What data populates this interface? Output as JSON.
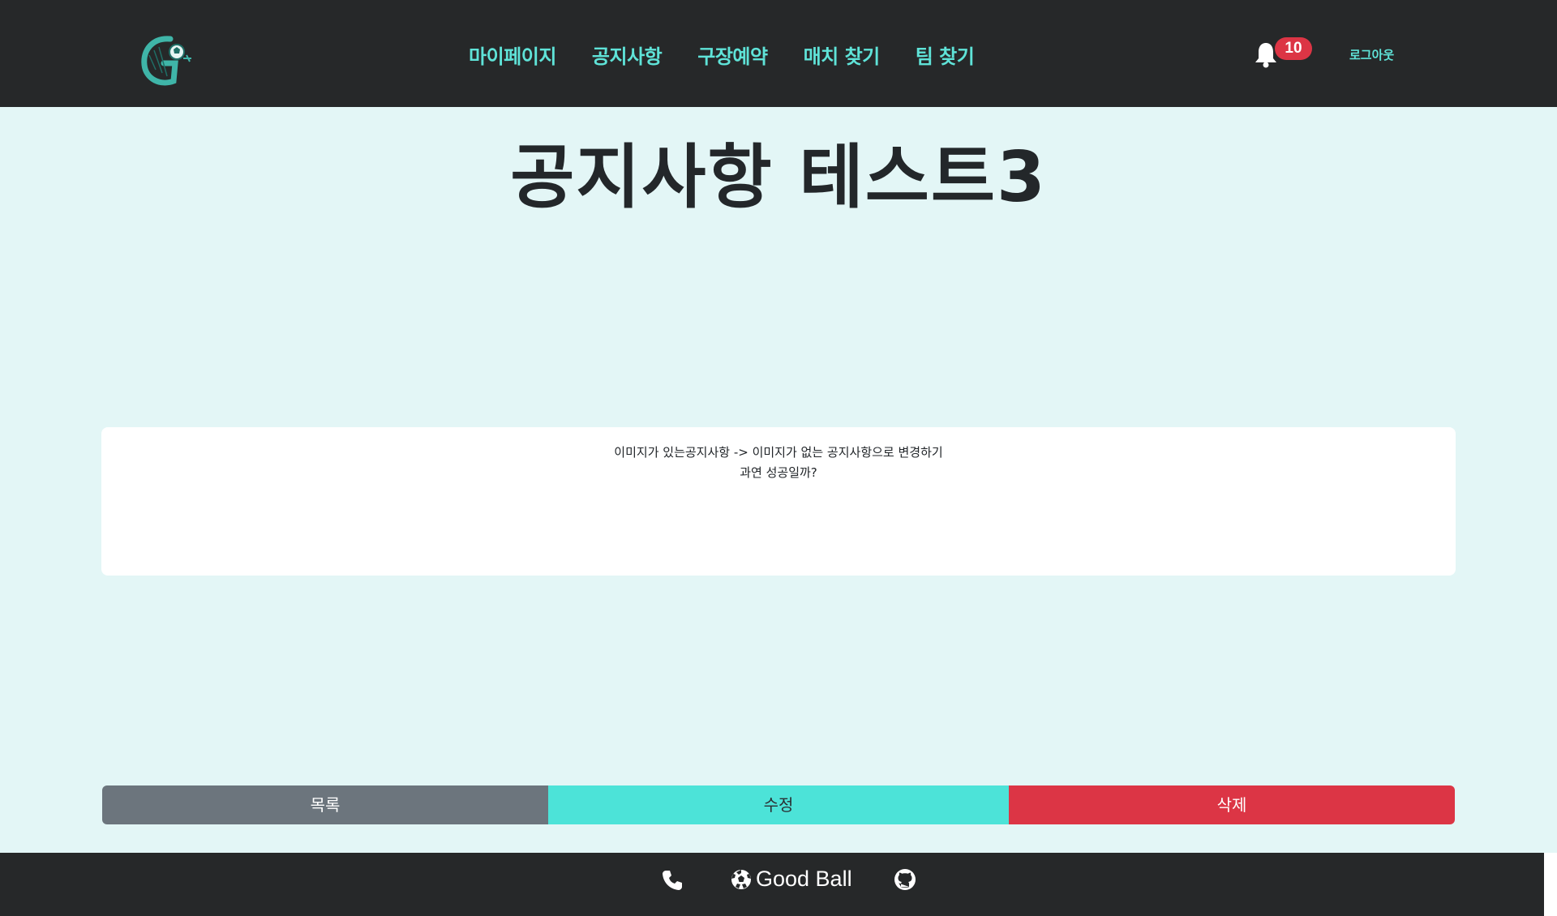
{
  "header": {
    "nav": [
      "마이페이지",
      "공지사항",
      "구장예약",
      "매치 찾기",
      "팀 찾기"
    ],
    "notification_count": "10",
    "logout_label": "로그아웃"
  },
  "post": {
    "title": "공지사항 테스트3",
    "content_lines": [
      "이미지가 있는공지사항 -> 이미지가 없는 공지사항으로 변경하기",
      "과연 성공일까?"
    ]
  },
  "actions": {
    "list_label": "목록",
    "edit_label": "수정",
    "delete_label": "삭제"
  },
  "footer": {
    "brand": "Good Ball"
  },
  "colors": {
    "header_bg": "#262829",
    "accent": "#5fe3d8",
    "page_bg": "#e3f6f6",
    "danger": "#dc3545",
    "secondary": "#6c757d"
  },
  "icons": [
    "logo",
    "bell-icon",
    "phone-icon",
    "soccer-ball-icon",
    "github-icon"
  ]
}
